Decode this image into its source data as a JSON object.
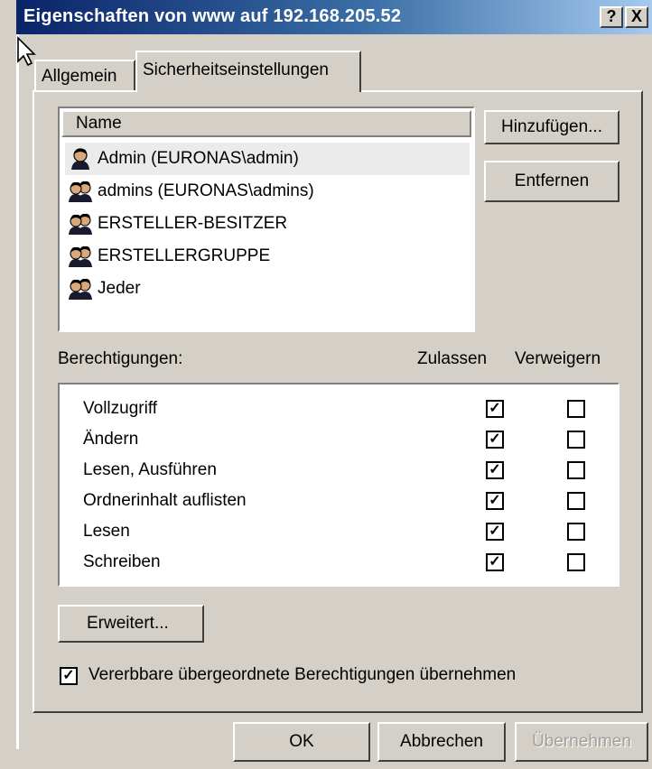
{
  "window": {
    "title": "Eigenschaften von www auf 192.168.205.52",
    "help_label": "?",
    "close_label": "X"
  },
  "tabs": [
    {
      "label": "Allgemein",
      "active": false
    },
    {
      "label": "Sicherheitseinstellungen",
      "active": true
    }
  ],
  "users": {
    "header": "Name",
    "items": [
      {
        "name": "Admin (EURONAS\\admin)",
        "icon": "user-icon",
        "selected": true
      },
      {
        "name": "admins (EURONAS\\admins)",
        "icon": "group-icon",
        "selected": false
      },
      {
        "name": "ERSTELLER-BESITZER",
        "icon": "group-icon",
        "selected": false
      },
      {
        "name": "ERSTELLERGRUPPE",
        "icon": "group-icon",
        "selected": false
      },
      {
        "name": "Jeder",
        "icon": "group-icon",
        "selected": false
      }
    ],
    "add_label": "Hinzufügen...",
    "remove_label": "Entfernen"
  },
  "permissions": {
    "label": "Berechtigungen:",
    "allow_header": "Zulassen",
    "deny_header": "Verweigern",
    "rows": [
      {
        "name": "Vollzugriff",
        "allow": true,
        "deny": false
      },
      {
        "name": "Ändern",
        "allow": true,
        "deny": false
      },
      {
        "name": "Lesen, Ausführen",
        "allow": true,
        "deny": false
      },
      {
        "name": "Ordnerinhalt auflisten",
        "allow": true,
        "deny": false
      },
      {
        "name": "Lesen",
        "allow": true,
        "deny": false
      },
      {
        "name": "Schreiben",
        "allow": true,
        "deny": false
      }
    ],
    "advanced_label": "Erweitert...",
    "inherit_label": "Vererbbare übergeordnete Berechtigungen übernehmen",
    "inherit_checked": true
  },
  "footer": {
    "ok_label": "OK",
    "cancel_label": "Abbrechen",
    "apply_label": "Übernehmen"
  },
  "colors": {
    "titlebar_start": "#0a246a",
    "titlebar_end": "#a6caf0",
    "face": "#d4d0c8"
  }
}
